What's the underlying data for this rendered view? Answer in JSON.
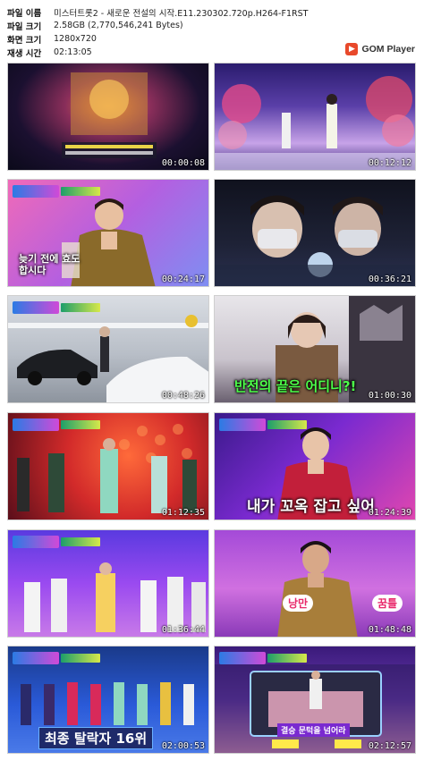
{
  "info": {
    "rows": [
      {
        "label": "파일 이름",
        "value": "미스터트롯2 - 새로운 전설의 시작.E11.230302.720p.H264-F1RST"
      },
      {
        "label": "파일 크기",
        "value": "2.58GB (2,770,546,241 Bytes)"
      },
      {
        "label": "화면 크기",
        "value": "1280x720"
      },
      {
        "label": "재생 시간",
        "value": "02:13:05"
      }
    ]
  },
  "brand": {
    "name": "GOM Player",
    "icon": "gom-player-icon"
  },
  "thumbnails": [
    {
      "timestamp": "00:00:08",
      "caption": ""
    },
    {
      "timestamp": "00:12:12",
      "caption": ""
    },
    {
      "timestamp": "00:24:17",
      "caption": "늦기 전에 효도합시다"
    },
    {
      "timestamp": "00:36:21",
      "caption": ""
    },
    {
      "timestamp": "00:48:26",
      "caption": ""
    },
    {
      "timestamp": "01:00:30",
      "caption": "반전의 끝은 어디니?!"
    },
    {
      "timestamp": "01:12:35",
      "caption": ""
    },
    {
      "timestamp": "01:24:39",
      "caption": "내가 꼬옥 잡고 싶어"
    },
    {
      "timestamp": "01:36:44",
      "caption": ""
    },
    {
      "timestamp": "01:48:48",
      "caption": ""
    },
    {
      "timestamp": "02:00:53",
      "caption": "최종 탈락자 16위"
    },
    {
      "timestamp": "02:12:57",
      "caption": "결승 문턱을 넘어라"
    }
  ],
  "extra_captions": {
    "t10_left": "낭만",
    "t10_right": "꿈틀"
  }
}
